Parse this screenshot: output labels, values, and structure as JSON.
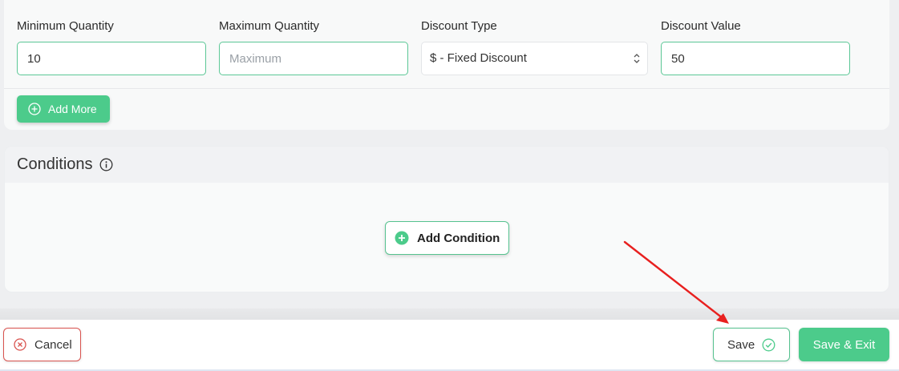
{
  "tiers": {
    "min_qty": {
      "label": "Minimum Quantity",
      "value": "10"
    },
    "max_qty": {
      "label": "Maximum Quantity",
      "value": "",
      "placeholder": "Maximum"
    },
    "discount_type": {
      "label": "Discount Type",
      "selected": "$ - Fixed Discount"
    },
    "discount_value": {
      "label": "Discount Value",
      "value": "50"
    },
    "add_more_label": "Add More"
  },
  "conditions": {
    "title": "Conditions",
    "add_condition_label": "Add Condition"
  },
  "footer": {
    "cancel_label": "Cancel",
    "save_label": "Save",
    "save_exit_label": "Save & Exit"
  },
  "colors": {
    "accent_green": "#4ccb8b",
    "danger_red": "#d9534f",
    "annotation_red": "#e8201f"
  },
  "icons": {
    "add_more": "plus-circle-outline-icon",
    "conditions_info": "info-circle-icon",
    "add_condition": "plus-circle-filled-icon",
    "cancel": "x-circle-icon",
    "save": "check-circle-icon",
    "select": "chevron-up-down-icon"
  }
}
